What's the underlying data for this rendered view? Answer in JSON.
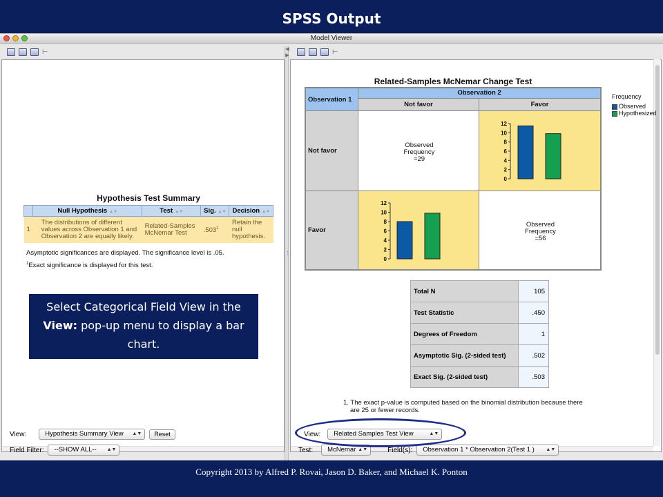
{
  "slide": {
    "title": "SPSS Output",
    "callout_pre": "Select Categorical Field View in the ",
    "callout_bold": "View:",
    "callout_post": " pop-up menu to display a bar chart.",
    "copyright": "Copyright 2013 by Alfred P. Rovai, Jason D. Baker, and Michael K. Ponton"
  },
  "window": {
    "title": "Model Viewer"
  },
  "left": {
    "hts_title": "Hypothesis Test Summary",
    "columns": [
      "",
      "Null Hypothesis",
      "Test",
      "Sig.",
      "Decision"
    ],
    "row": {
      "num": "1",
      "hypothesis": "The distributions of different values across Observation 1 and Observation 2 are equally likely.",
      "test": "Related-Samples McNemar Test",
      "sig": ".503",
      "sig_sup": "1",
      "decision": "Retain the null hypothesis."
    },
    "note1": "Asymptotic significances are displayed.  The significance level is .05.",
    "note2_sup": "1",
    "note2": "Exact significance is displayed for this test.",
    "view_label": "View:",
    "view_value": "Hypothesis Summary View",
    "reset_label": "Reset",
    "filter_label": "Field Filter:",
    "filter_value": "--SHOW ALL--"
  },
  "right": {
    "mc_title": "Related-Samples McNemar Change Test",
    "obs1": "Observation 1",
    "obs2": "Observation 2",
    "col_not_favor": "Not favor",
    "col_favor": "Favor",
    "row_not_favor": "Not favor",
    "row_favor": "Favor",
    "cell_nf_nf": [
      "Observed",
      "Frequency",
      "=29"
    ],
    "cell_f_f": [
      "Observed",
      "Frequency",
      "=56"
    ],
    "legend_title": "Frequency",
    "legend_observed": "Observed",
    "legend_hypothesized": "Hypothesized",
    "colors": {
      "observed": "#0c5aa6",
      "hypothesized": "#14a050"
    },
    "stats": [
      {
        "label": "Total N",
        "value": "105"
      },
      {
        "label": "Test Statistic",
        "value": ".450"
      },
      {
        "label": "Degrees of Freedom",
        "value": "1"
      },
      {
        "label": "Asymptotic Sig. (2-sided test)",
        "value": ".502"
      },
      {
        "label": "Exact Sig. (2-sided test)",
        "value": ".503"
      }
    ],
    "footnote_a": "1.  The exact p-value is computed based on the binomial distribution because there",
    "footnote_b": "are 25 or fewer records.",
    "view_label": "View:",
    "view_value": "Related Samples Test View",
    "test_label": "Test:",
    "test_value": "McNemar",
    "fields_label": "Field(s):",
    "fields_value": "Observation 1 * Observation 2(Test 1 )"
  },
  "chart_data": [
    {
      "type": "bar",
      "cell": "Not favor x Favor",
      "categories": [
        "Observed",
        "Hypothesized"
      ],
      "values": [
        11.5,
        9.8
      ],
      "yticks": [
        "0",
        "2",
        "4",
        "6",
        "8",
        "10",
        "12"
      ],
      "ylim": [
        0,
        12
      ]
    },
    {
      "type": "bar",
      "cell": "Favor x Not favor",
      "categories": [
        "Observed",
        "Hypothesized"
      ],
      "values": [
        8,
        9.8
      ],
      "yticks": [
        "0",
        "2",
        "4",
        "6",
        "8",
        "10",
        "12"
      ],
      "ylim": [
        0,
        12
      ]
    }
  ]
}
